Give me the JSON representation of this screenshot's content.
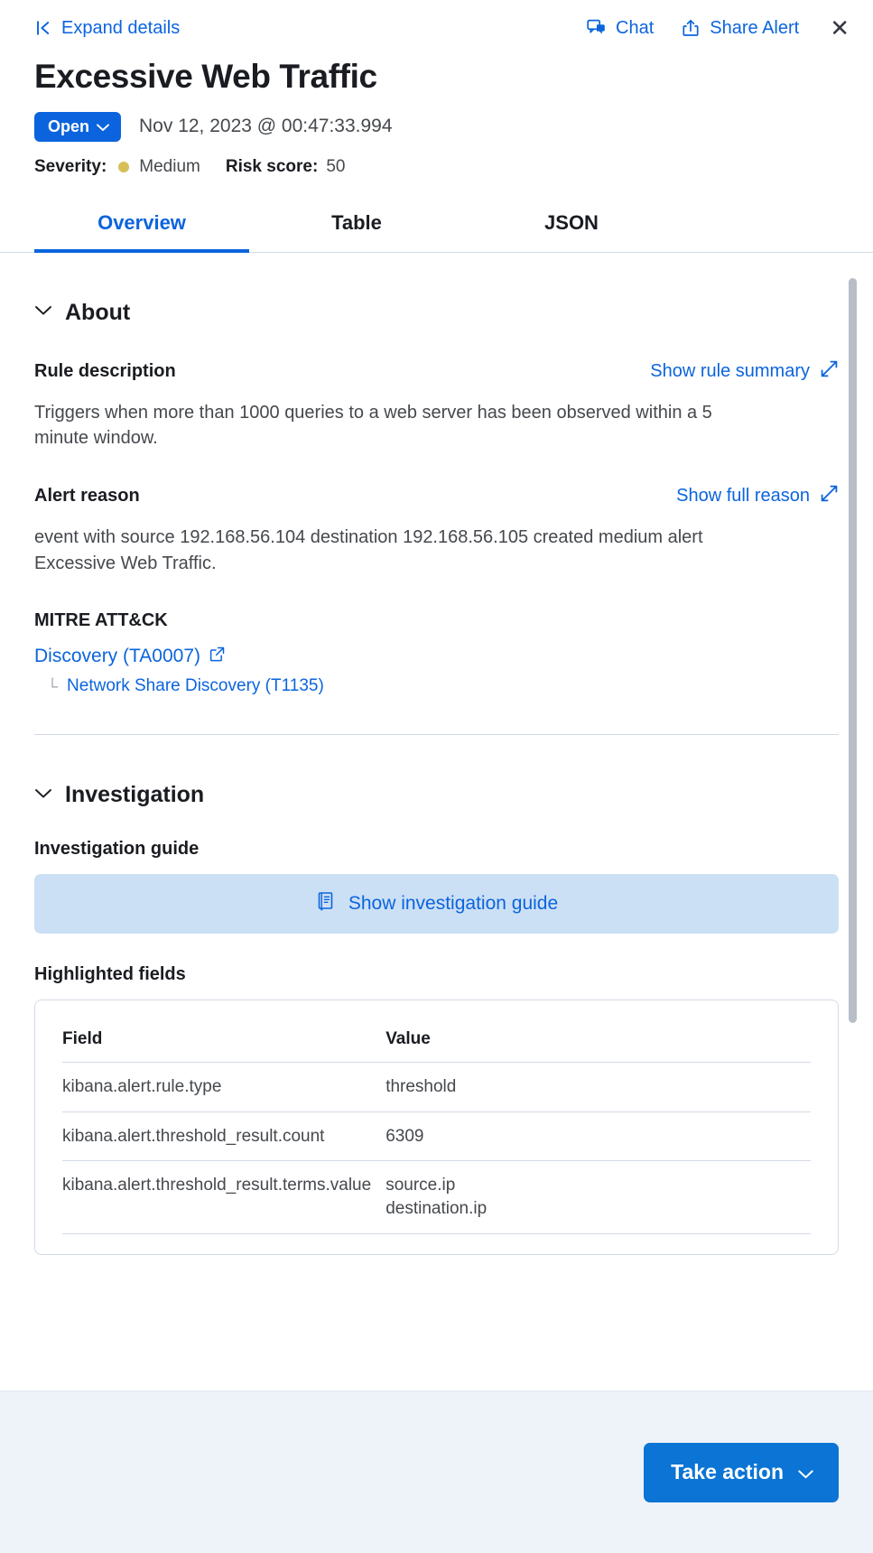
{
  "topbar": {
    "expand_label": "Expand details",
    "chat_label": "Chat",
    "share_label": "Share Alert",
    "close_label": "✕"
  },
  "alert": {
    "title": "Excessive Web Traffic",
    "status": "Open",
    "timestamp": "Nov 12, 2023 @ 00:47:33.994",
    "severity_label": "Severity:",
    "severity_value": "Medium",
    "severity_color": "#d6bf57",
    "risk_label": "Risk score:",
    "risk_value": "50"
  },
  "tabs": [
    {
      "label": "Overview",
      "active": true
    },
    {
      "label": "Table",
      "active": false
    },
    {
      "label": "JSON",
      "active": false
    }
  ],
  "about": {
    "section_title": "About",
    "rule_description_label": "Rule description",
    "show_rule_summary_label": "Show rule summary",
    "rule_description_text": "Triggers when more than 1000 queries to a web server has been observed within a 5 minute window.",
    "alert_reason_label": "Alert reason",
    "show_full_reason_label": "Show full reason",
    "alert_reason_text": "event with source 192.168.56.104 destination 192.168.56.105 created medium alert Excessive Web Traffic.",
    "mitre_label": "MITRE ATT&CK",
    "mitre_tactic": "Discovery (TA0007)",
    "mitre_technique": "Network Share Discovery (T1135)"
  },
  "investigation": {
    "section_title": "Investigation",
    "guide_label": "Investigation guide",
    "show_guide_button": "Show investigation guide",
    "highlighted_fields_label": "Highlighted fields",
    "table": {
      "headers": [
        "Field",
        "Value"
      ],
      "rows": [
        {
          "field": "kibana.alert.rule.type",
          "value": "threshold"
        },
        {
          "field": "kibana.alert.threshold_result.count",
          "value": "6309"
        },
        {
          "field": "kibana.alert.threshold_result.terms.value",
          "value": "source.ip\ndestination.ip"
        }
      ]
    }
  },
  "footer": {
    "take_action_label": "Take action"
  },
  "colors": {
    "accent_blue": "#0b64dd",
    "button_blue": "#0b74d4",
    "guide_bg": "#cce0f5",
    "footer_bg": "#eef2f9"
  }
}
